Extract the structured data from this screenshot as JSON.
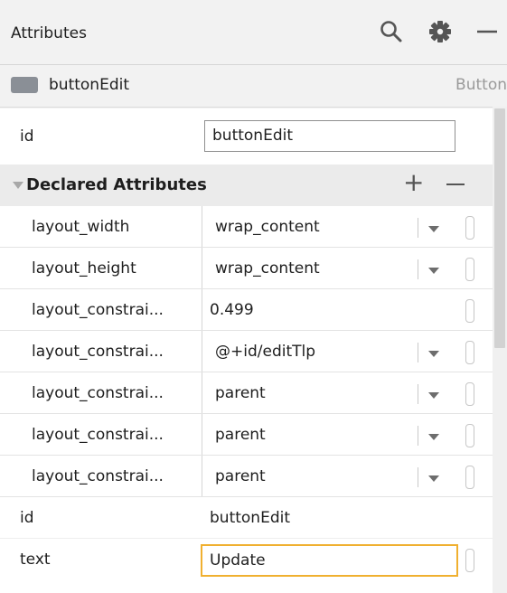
{
  "header": {
    "title": "Attributes",
    "icons": [
      "search-icon",
      "gear-icon",
      "minimize-icon"
    ]
  },
  "component": {
    "name": "buttonEdit",
    "type": "Button"
  },
  "id_field": {
    "label": "id",
    "value": "buttonEdit"
  },
  "section": {
    "title": "Declared Attributes",
    "add_label": "+",
    "remove_label": "−"
  },
  "rows": [
    {
      "name": "layout_width",
      "value": "wrap_content"
    },
    {
      "name": "layout_height",
      "value": "wrap_content"
    },
    {
      "name": "layout_constrai...",
      "value": "0.499"
    },
    {
      "name": "layout_constrai...",
      "value": "@+id/editTlp"
    },
    {
      "name": "layout_constrai...",
      "value": "parent"
    },
    {
      "name": "layout_constrai...",
      "value": "parent"
    },
    {
      "name": "layout_constrai...",
      "value": "parent"
    }
  ],
  "extra_rows": [
    {
      "name": "id",
      "value": "buttonEdit"
    },
    {
      "name": "text",
      "value": "Update"
    }
  ],
  "colors": {
    "focus_border": "#f0b030",
    "component_swatch": "#8a8f96"
  }
}
